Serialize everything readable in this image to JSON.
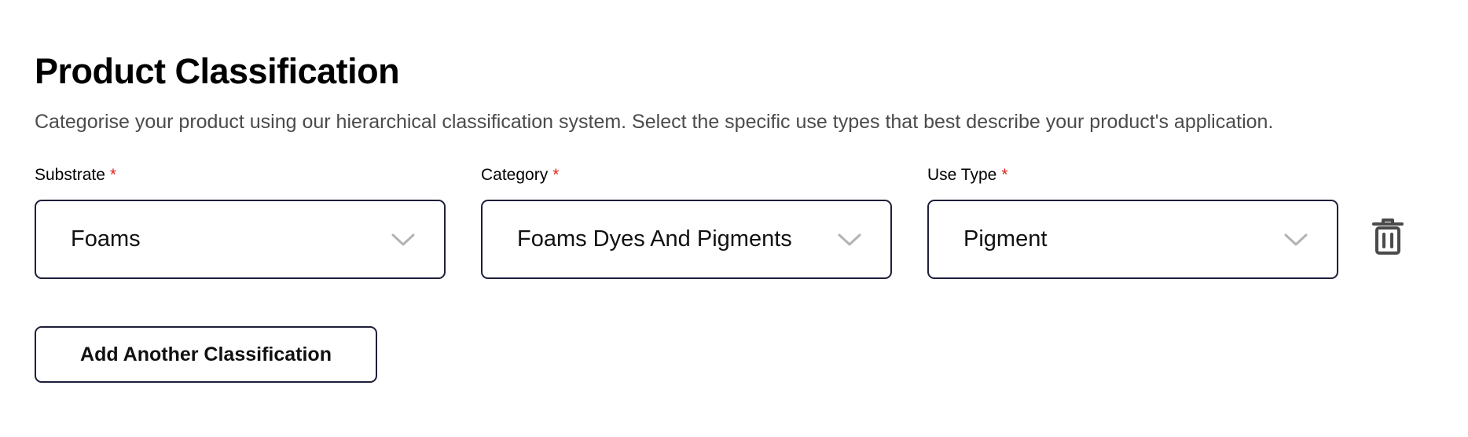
{
  "section": {
    "title": "Product Classification",
    "description": "Categorise your product using our hierarchical classification system. Select the specific use types that best describe your product's application."
  },
  "fields": [
    {
      "label": "Substrate",
      "required_marker": "*",
      "value": "Foams"
    },
    {
      "label": "Category",
      "required_marker": "*",
      "value": "Foams Dyes And Pigments"
    },
    {
      "label": "Use Type",
      "required_marker": "*",
      "value": "Pigment"
    }
  ],
  "actions": {
    "add_label": "Add Another Classification",
    "delete_icon": "trash-icon"
  },
  "colors": {
    "required": "#e0241b",
    "border": "#1e1f3a",
    "chevron": "#b3b3b3",
    "trash": "#4a4a4a",
    "description_text": "#4b4b4b"
  }
}
